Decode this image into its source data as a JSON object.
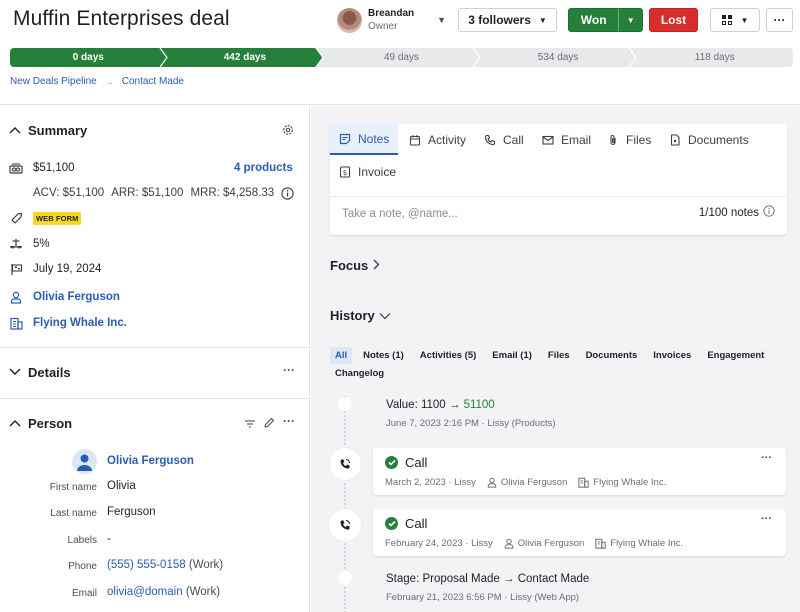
{
  "header": {
    "title": "Muffin Enterprises deal",
    "owner": {
      "name": "Breandan",
      "role": "Owner"
    },
    "followers_label": "3 followers",
    "won_label": "Won",
    "lost_label": "Lost",
    "more_label": "···"
  },
  "pipeline": {
    "stages": [
      {
        "label": "0 days",
        "status": "done"
      },
      {
        "label": "442 days",
        "status": "done"
      },
      {
        "label": "49 days",
        "status": "todo"
      },
      {
        "label": "534 days",
        "status": "todo"
      },
      {
        "label": "118 days",
        "status": "todo"
      }
    ],
    "colors": {
      "done": "#25803b",
      "todo": "#e8e9eb"
    }
  },
  "breadcrumb": {
    "pipeline": "New Deals Pipeline",
    "arrow": "→",
    "stage": "Contact Made"
  },
  "summary": {
    "title": "Summary",
    "value": "$51,100",
    "products_link": "4 products",
    "acv": "ACV: $51,100",
    "arr": "ARR: $51,100",
    "mrr": "MRR: $4,258.33",
    "label_badge": "WEB FORM",
    "probability": "5%",
    "expected_close": "July 19, 2024",
    "person": "Olivia Ferguson",
    "organization": "Flying Whale Inc."
  },
  "details": {
    "title": "Details",
    "more": "···"
  },
  "person": {
    "title": "Person",
    "more": "···",
    "name": "Olivia Ferguson",
    "fields": {
      "first_name_label": "First name",
      "first_name": "Olivia",
      "last_name_label": "Last name",
      "last_name": "Ferguson",
      "labels_label": "Labels",
      "labels": "-",
      "phone_label": "Phone",
      "phone": "(555) 555-0158",
      "phone_type": "(Work)",
      "email_label": "Email",
      "email": "olivia@domain",
      "email_type": "(Work)"
    }
  },
  "composer": {
    "tabs": [
      {
        "label": "Notes",
        "icon": "note-icon",
        "active": true
      },
      {
        "label": "Activity",
        "icon": "calendar-icon"
      },
      {
        "label": "Call",
        "icon": "phone-icon"
      },
      {
        "label": "Email",
        "icon": "envelope-icon"
      },
      {
        "label": "Files",
        "icon": "paperclip-icon"
      },
      {
        "label": "Documents",
        "icon": "document-icon"
      },
      {
        "label": "Invoice",
        "icon": "invoice-icon"
      }
    ],
    "placeholder": "Take a note, @name...",
    "note_count": "1/100 notes"
  },
  "focus": {
    "title": "Focus",
    "chevron": "›"
  },
  "history": {
    "title": "History",
    "filters": [
      {
        "label": "All",
        "active": true
      },
      {
        "label": "Notes (1)"
      },
      {
        "label": "Activities (5)"
      },
      {
        "label": "Email (1)"
      },
      {
        "label": "Files"
      },
      {
        "label": "Documents"
      },
      {
        "label": "Invoices"
      },
      {
        "label": "Engagement"
      },
      {
        "label": "Changelog"
      }
    ],
    "events": [
      {
        "type": "change",
        "field": "Value",
        "old": "1100",
        "new": "51100",
        "meta": "June 7, 2023 2:16 PM · Lissy (Products)"
      },
      {
        "type": "call",
        "title": "Call",
        "date": "March 2, 2023 · Lissy",
        "person": "Olivia Ferguson",
        "org": "Flying Whale Inc.",
        "more": "···"
      },
      {
        "type": "call",
        "title": "Call",
        "date": "February 24, 2023 · Lissy",
        "person": "Olivia Ferguson",
        "org": "Flying Whale Inc.",
        "more": "···"
      },
      {
        "type": "change",
        "field": "Stage",
        "old": "Proposal Made",
        "new": "Contact Made",
        "meta": "February 21, 2023 6:56 PM · Lissy (Web App)"
      }
    ]
  },
  "colors": {
    "accent_blue": "#2a5cb0",
    "won_green": "#25803b",
    "lost_red": "#d82d2d",
    "badge_yellow": "#f8d723"
  }
}
